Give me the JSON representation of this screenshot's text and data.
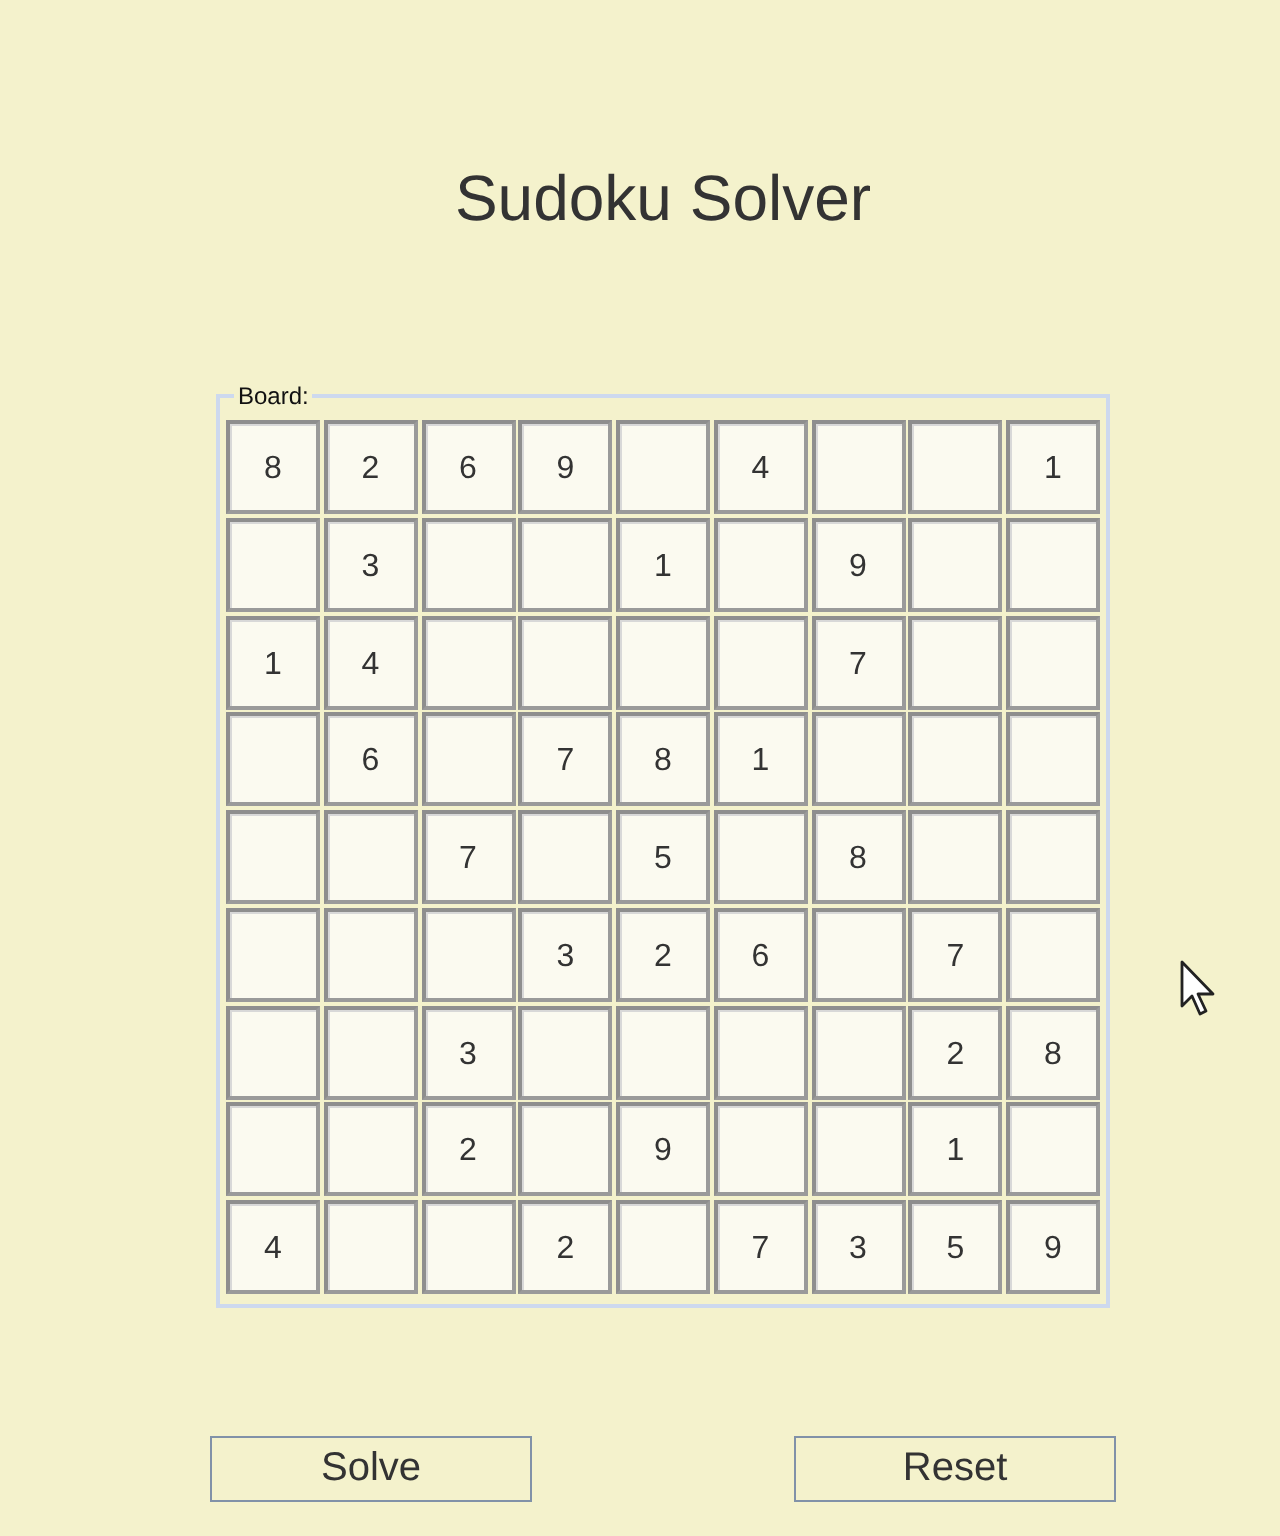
{
  "title": "Sudoku Solver",
  "board": {
    "legend": "Board:",
    "rows": [
      [
        "8",
        "2",
        "6",
        "9",
        null,
        "4",
        null,
        null,
        "1"
      ],
      [
        null,
        "3",
        null,
        null,
        "1",
        null,
        "9",
        null,
        null
      ],
      [
        "1",
        "4",
        null,
        null,
        null,
        null,
        "7",
        null,
        null
      ],
      [
        null,
        "6",
        null,
        "7",
        "8",
        "1",
        null,
        null,
        null
      ],
      [
        null,
        null,
        "7",
        null,
        "5",
        null,
        "8",
        null,
        null
      ],
      [
        null,
        null,
        null,
        "3",
        "2",
        "6",
        null,
        "7",
        null
      ],
      [
        null,
        null,
        "3",
        null,
        null,
        null,
        null,
        "2",
        "8"
      ],
      [
        null,
        null,
        "2",
        null,
        "9",
        null,
        null,
        "1",
        null
      ],
      [
        "4",
        null,
        null,
        "2",
        null,
        "7",
        "3",
        "5",
        "9"
      ]
    ]
  },
  "buttons": [
    {
      "label": "Solve"
    },
    {
      "label": "Reset"
    }
  ]
}
